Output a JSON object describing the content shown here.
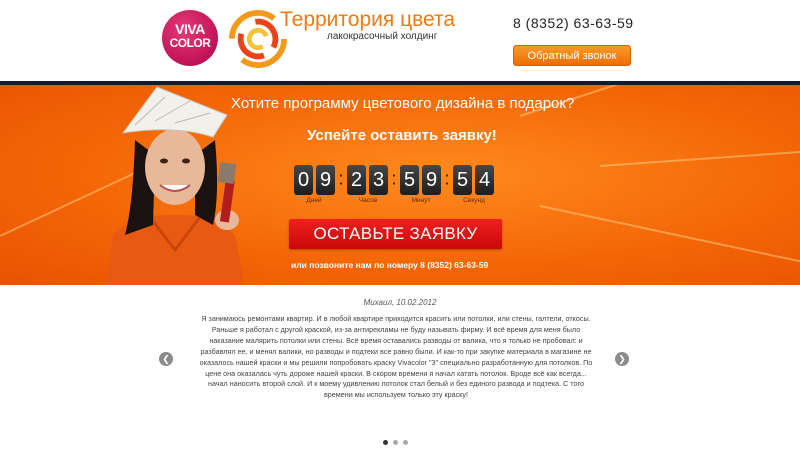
{
  "header": {
    "viva_logo_line1": "VIVA",
    "viva_logo_line2": "COLOR",
    "brand_title": "Территория цвета",
    "brand_subtitle": "лакокрасочный холдинг",
    "phone": "8 (8352) 63-63-59",
    "callback_button": "Обратный звонок"
  },
  "hero": {
    "question": "Хотите программу цветового дизайна в подарок?",
    "cta": "Успейте оставить заявку!",
    "timer": {
      "digits": [
        "0",
        "9",
        "2",
        "3",
        "5",
        "9",
        "5",
        "4"
      ],
      "labels": [
        "Дней",
        "Часов",
        "Минут",
        "Секунд"
      ]
    },
    "order_button": "ОСТАВЬТЕ ЗАЯВКУ",
    "call_text": "или позвоните нам по номеру 8 (8352) 63-63-59"
  },
  "testimonial": {
    "author": "Михаил, 10.02.2012",
    "lines": [
      "Я занимаюсь ремонтами квартир. И в любой квартире приходится красить или потолки, или стены, галтели, откосы.",
      "Раньше я работал с другой краской, из-за антирекламы не буду называть фирму. И всё время для меня было",
      "наказание малярить потолки или стены. Всё время оставались разводы от валика, что я только не пробовал: и",
      "разбавлял ее, и менял валики, но разводы и подтеки все равно были. И как-то при закупке материала в магазине не",
      "оказалось нашей краски и мы решили попробовать краску Vivacolor \"3\" специально разработанную для потолков. По",
      "цене она оказалась чуть дороже нашей краски. В скором времени я начал катать потолок. Вроде всё как всегда...",
      "начал наносить второй слой. И к моему удивлению потолок стал белый и без единого развода и подтека. С того",
      "времени мы используем только эту краску!"
    ],
    "prev_icon": "chevron-left-icon",
    "next_icon": "chevron-right-icon",
    "slide_count": 3,
    "active_slide": 1
  },
  "colors": {
    "brand_orange": "#f07a10",
    "hero_orange": "#f46808",
    "order_red": "#e01414",
    "viva_magenta": "#c01256"
  }
}
